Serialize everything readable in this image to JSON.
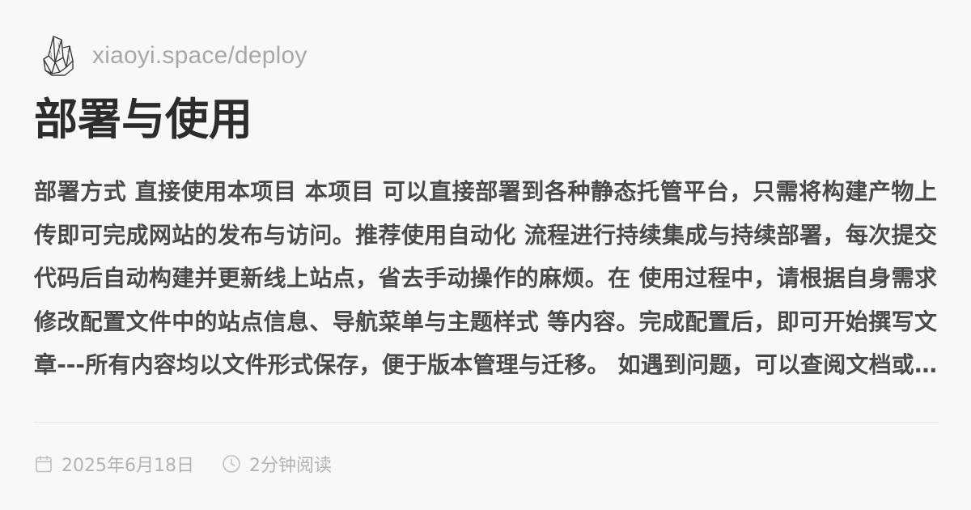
{
  "site": {
    "url": "xiaoyi.space/deploy",
    "logo_icon": "crystal-cluster-icon"
  },
  "post": {
    "title": "部署与使用",
    "excerpt": "部署方式 直接使用本项目 本项目 可以直接部署到各种静态托管平台，只需将构建产物上传即可完成网站的发布与访问。推荐使用自动化 流程进行持续集成与持续部署，每次提交代码后自动构建并更新线上站点，省去手动操作的麻烦。在 使用过程中，请根据自身需求修改配置文件中的站点信息、导航菜单与主题样式 等内容。完成配置后，即可开始撰写文章---所有内容均以文件形式保存，便于版本管理与迁移。 如遇到问题，可以查阅文档或在项目仓库中提交反馈，我们会尽快回复并协助解决你在部署与使用过程中遇到的各种问题，感谢你的支持与使用。 更多详细说明请参阅文档 常见问题解答…",
    "date": "2025年6月18日",
    "read_time": "2分钟阅读"
  },
  "icons": {
    "date": "calendar-icon",
    "read_time": "clock-icon"
  },
  "colors": {
    "background": "#f9f8f9",
    "title": "#2c2c2c",
    "body": "#4a4a4a",
    "muted": "#a8a8a8",
    "divider": "#e6e4e6"
  }
}
